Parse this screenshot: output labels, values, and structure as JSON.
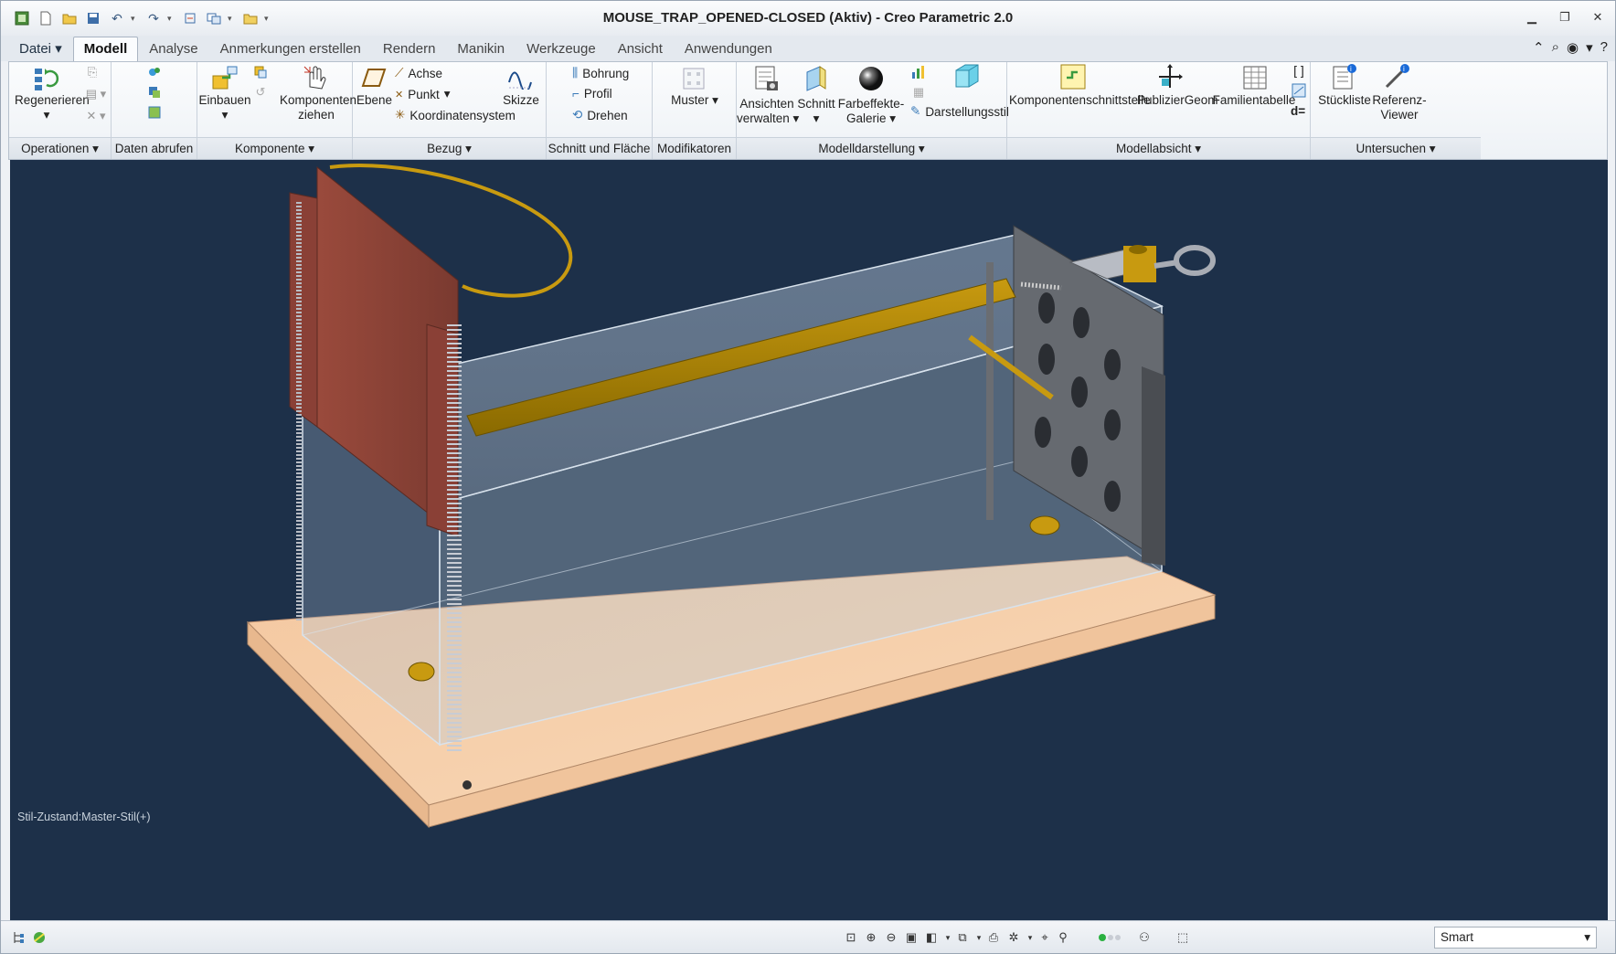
{
  "window": {
    "title": "MOUSE_TRAP_OPENED-CLOSED (Aktiv) - Creo Parametric 2.0"
  },
  "tabs": [
    {
      "label": "Datei"
    },
    {
      "label": "Modell"
    },
    {
      "label": "Analyse"
    },
    {
      "label": "Anmerkungen erstellen"
    },
    {
      "label": "Rendern"
    },
    {
      "label": "Manikin"
    },
    {
      "label": "Werkzeuge"
    },
    {
      "label": "Ansicht"
    },
    {
      "label": "Anwendungen"
    }
  ],
  "ribbon": {
    "groups": {
      "operationen": "Operationen",
      "daten_abrufen": "Daten abrufen",
      "komponente": "Komponente",
      "bezug": "Bezug",
      "schnitt_flaeche": "Schnitt und Fläche",
      "modifikatoren": "Modifikatoren",
      "modelldarstellung": "Modelldarstellung",
      "modellabsicht": "Modellabsicht",
      "untersuchen": "Untersuchen"
    },
    "regenerieren": "Regenerieren",
    "einbauen": "Einbauen",
    "komponenten_ziehen_1": "Komponenten",
    "komponenten_ziehen_2": "ziehen",
    "ebene": "Ebene",
    "achse": "Achse",
    "punkt": "Punkt",
    "koordinatensystem": "Koordinatensystem",
    "skizze": "Skizze",
    "bohrung": "Bohrung",
    "profil": "Profil",
    "drehen": "Drehen",
    "muster": "Muster",
    "ansichten_1": "Ansichten",
    "ansichten_2": "verwalten",
    "schnitt": "Schnitt",
    "farbeffekte_1": "Farbeffekte-",
    "farbeffekte_2": "Galerie",
    "darstellungsstil": "Darstellungsstil",
    "komponentenschnittstelle": "Komponentenschnittstelle",
    "publiziergeom": "PublizierGeom",
    "familientabelle": "Familientabelle",
    "d_eq": "d=",
    "stueckliste": "Stückliste",
    "referenz_1": "Referenz-",
    "referenz_2": "Viewer"
  },
  "viewport": {
    "style_state": "Stil-Zustand:Master-Stil(+)"
  },
  "statusbar": {
    "filter": "Smart"
  }
}
